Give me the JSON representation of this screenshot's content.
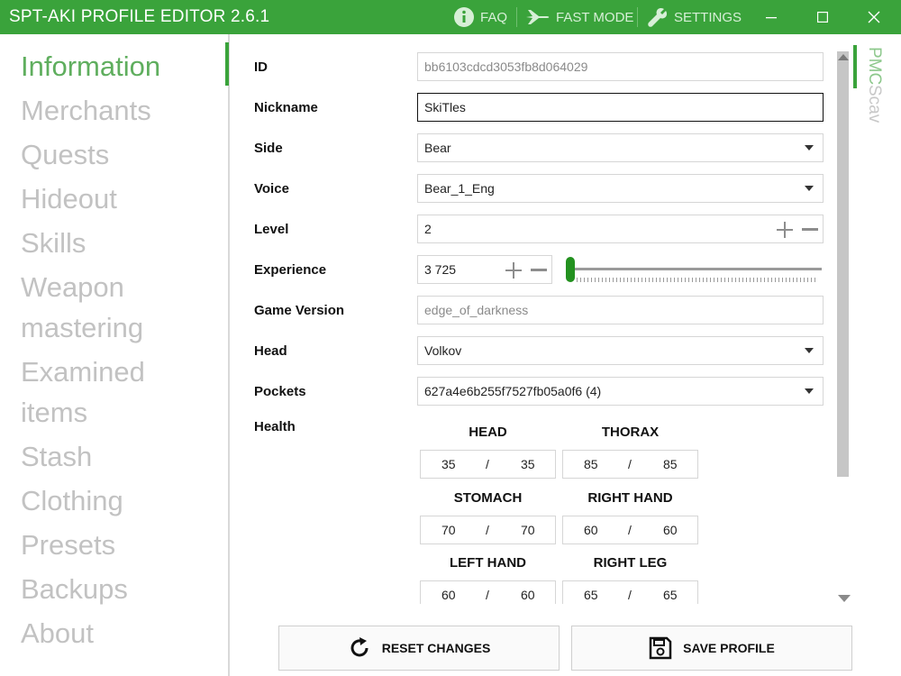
{
  "app": {
    "title": "SPT-AKI PROFILE EDITOR  2.6.1"
  },
  "toolbar": {
    "faq": "FAQ",
    "fast_mode": "FAST MODE",
    "settings": "SETTINGS"
  },
  "window_controls": {
    "minimize": "minimize-icon",
    "maximize": "maximize-icon",
    "close": "close-icon"
  },
  "nav": {
    "active": "Information",
    "items": [
      {
        "label": "Information"
      },
      {
        "label": "Merchants"
      },
      {
        "label": "Quests"
      },
      {
        "label": "Hideout"
      },
      {
        "label": "Skills"
      },
      {
        "label": "Weapon"
      },
      {
        "label": "mastering"
      },
      {
        "label": "Examined"
      },
      {
        "label": "items"
      },
      {
        "label": "Stash"
      },
      {
        "label": "Clothing"
      },
      {
        "label": "Presets"
      },
      {
        "label": "Backups"
      },
      {
        "label": "About"
      }
    ]
  },
  "form": {
    "id": {
      "label": "ID",
      "value": "bb6103cdcd3053fb8d064029"
    },
    "nickname": {
      "label": "Nickname",
      "value": "SkiTles"
    },
    "side": {
      "label": "Side",
      "value": "Bear"
    },
    "voice": {
      "label": "Voice",
      "value": "Bear_1_Eng"
    },
    "level": {
      "label": "Level",
      "value": "2"
    },
    "experience": {
      "label": "Experience",
      "value": "3 725",
      "slider_fraction": 0.0
    },
    "game_version": {
      "label": "Game Version",
      "value": "edge_of_darkness"
    },
    "head": {
      "label": "Head",
      "value": "Volkov"
    },
    "pockets": {
      "label": "Pockets",
      "value": "627a4e6b255f7527fb05a0f6 (4)"
    }
  },
  "health": {
    "label": "Health",
    "separator": "/",
    "parts": [
      {
        "name": "HEAD",
        "current": "35",
        "max": "35"
      },
      {
        "name": "THORAX",
        "current": "85",
        "max": "85"
      },
      {
        "name": "STOMACH",
        "current": "70",
        "max": "70"
      },
      {
        "name": "RIGHT HAND",
        "current": "60",
        "max": "60"
      },
      {
        "name": "LEFT HAND",
        "current": "60",
        "max": "60"
      },
      {
        "name": "RIGHT LEG",
        "current": "65",
        "max": "65"
      }
    ]
  },
  "side_tabs": {
    "pmc": "PMC",
    "scav": "Scav",
    "active": "PMC"
  },
  "actions": {
    "reset": "RESET CHANGES",
    "save": "SAVE PROFILE"
  },
  "colors": {
    "accent": "#3aa33b",
    "nav_active": "#5fae5e",
    "nav_inactive": "#c2c2c2"
  }
}
